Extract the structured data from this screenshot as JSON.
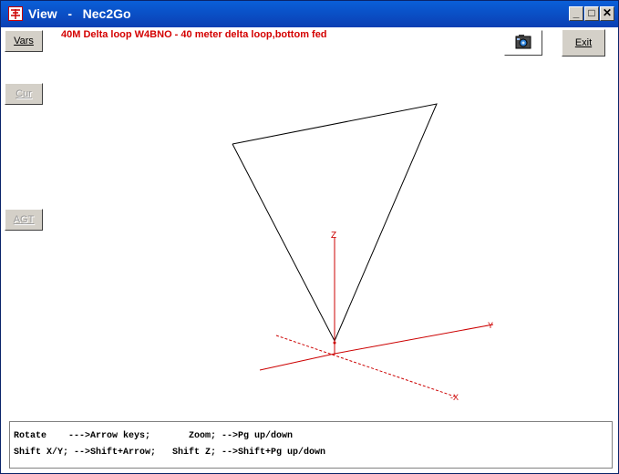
{
  "window": {
    "title": "View   -   Nec2Go",
    "minimize_glyph": "_",
    "maximize_glyph": "□",
    "close_glyph": "✕"
  },
  "heading": "40M Delta loop W4BNO - 40 meter delta loop,bottom fed",
  "sidebar": {
    "vars_label": "Vars",
    "cur_label": "Cur",
    "agt_label": "AGT"
  },
  "toolbar": {
    "exit_label": "Exit",
    "snapshot_icon": "camera-icon"
  },
  "axis": {
    "z_label": "Z"
  },
  "help": {
    "line1": "Rotate    --->Arrow keys;       Zoom; -->Pg up/down",
    "line2": "Shift X/Y; -->Shift+Arrow;   Shift Z; -->Shift+Pg up/down"
  },
  "colors": {
    "accent": "#d40000",
    "wire": "#000000",
    "axis": "#cc0000",
    "titlebar": "#0a5fd8"
  }
}
